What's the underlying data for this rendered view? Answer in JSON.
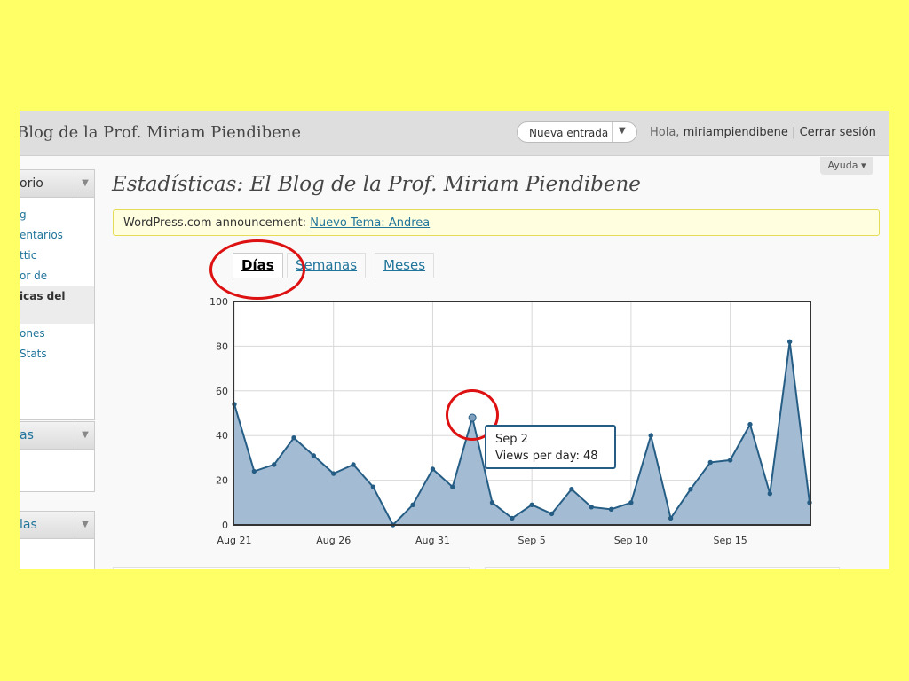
{
  "header": {
    "blog_title": "Blog de la Prof. Miriam Piendibene",
    "new_entry_button": "Nueva entrada",
    "greeting": "Hola,",
    "username": "miriampiendibene",
    "separator": "|",
    "logout": "Cerrar sesión",
    "help": "Ayuda"
  },
  "sidebar": {
    "menu1_title": "orio",
    "menu1_items": [
      "g",
      "entarios",
      "ttic",
      "or de",
      "icas del",
      "ones",
      "Stats"
    ],
    "menu1_current_index": 4,
    "menu2_title": "as",
    "menu3_title": "las"
  },
  "main": {
    "title": "Estadísticas: El Blog de la Prof. Miriam Piendibene",
    "announcement_prefix": "WordPress.com announcement:",
    "announcement_link": "Nuevo Tema: Andrea",
    "tabs": [
      "Días",
      "Semanas",
      "Meses"
    ],
    "active_tab": 0
  },
  "tooltip": {
    "date": "Sep 2",
    "label": "Views per day: 48"
  },
  "chart_data": {
    "type": "area",
    "title": "",
    "xlabel": "",
    "ylabel": "",
    "ylim": [
      0,
      100
    ],
    "yticks": [
      0,
      20,
      40,
      60,
      80,
      100
    ],
    "xtick_labels": [
      "Aug 21",
      "Aug 26",
      "Aug 31",
      "Sep 5",
      "Sep 10",
      "Sep 15"
    ],
    "grid": true,
    "x": [
      "Aug 21",
      "Aug 22",
      "Aug 23",
      "Aug 24",
      "Aug 25",
      "Aug 26",
      "Aug 27",
      "Aug 28",
      "Aug 29",
      "Aug 30",
      "Aug 31",
      "Sep 1",
      "Sep 2",
      "Sep 3",
      "Sep 4",
      "Sep 5",
      "Sep 6",
      "Sep 7",
      "Sep 8",
      "Sep 9",
      "Sep 10",
      "Sep 11",
      "Sep 12",
      "Sep 13",
      "Sep 14",
      "Sep 15",
      "Sep 16",
      "Sep 17",
      "Sep 18",
      "Sep 19"
    ],
    "series": [
      {
        "values": [
          54,
          24,
          27,
          39,
          31,
          23,
          27,
          17,
          0,
          9,
          25,
          17,
          48,
          10,
          3,
          9,
          5,
          16,
          8,
          7,
          10,
          40,
          3,
          16,
          28,
          29,
          45,
          14,
          82,
          10
        ]
      }
    ],
    "highlight_index": 12,
    "colors": {
      "fill": "#a3bcd3",
      "line": "#255d85",
      "frame": "#333333",
      "grid": "#d8d8d8"
    }
  },
  "annotations": {
    "color": "#dd1111"
  }
}
